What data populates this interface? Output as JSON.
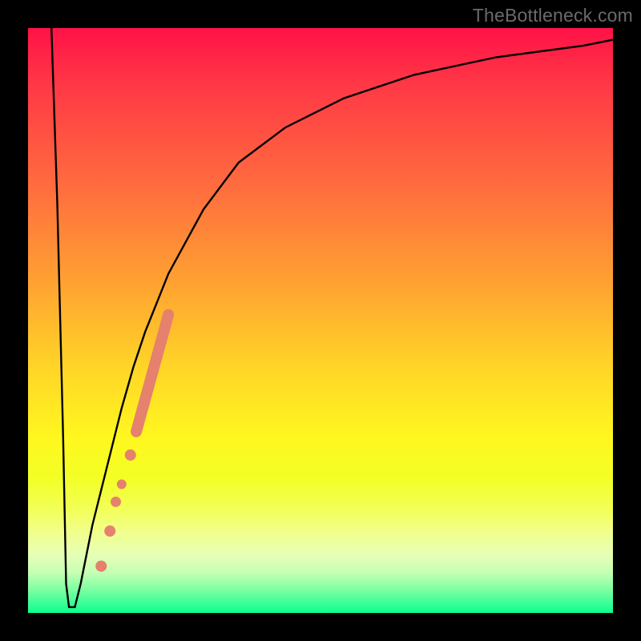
{
  "watermark": "TheBottleneck.com",
  "chart_data": {
    "type": "line",
    "title": "",
    "xlabel": "",
    "ylabel": "",
    "xlim": [
      0,
      100
    ],
    "ylim": [
      0,
      100
    ],
    "grid": false,
    "legend": false,
    "annotations": [],
    "series": [
      {
        "name": "bottleneck-curve",
        "color": "#000000",
        "x": [
          4,
          5,
          6,
          6.5,
          7,
          8,
          9,
          10,
          11,
          12,
          14,
          16,
          18,
          20,
          24,
          30,
          36,
          44,
          54,
          66,
          80,
          95,
          100
        ],
        "y": [
          100,
          70,
          30,
          5,
          1,
          1,
          5,
          10,
          15,
          19,
          27,
          35,
          42,
          48,
          58,
          69,
          77,
          83,
          88,
          92,
          95,
          97,
          98
        ]
      }
    ],
    "markers": [
      {
        "name": "dot-1",
        "x": 12.5,
        "y": 8,
        "r": 7,
        "color": "#e5816d"
      },
      {
        "name": "dot-2",
        "x": 14.0,
        "y": 14,
        "r": 7,
        "color": "#e5816d"
      },
      {
        "name": "dot-3",
        "x": 15.0,
        "y": 19,
        "r": 6.5,
        "color": "#e5816d"
      },
      {
        "name": "dot-4",
        "x": 16.0,
        "y": 22,
        "r": 6,
        "color": "#e5816d"
      },
      {
        "name": "dot-5",
        "x": 17.5,
        "y": 27,
        "r": 7,
        "color": "#e5816d"
      }
    ],
    "segments": [
      {
        "name": "thick-segment",
        "x1": 18.5,
        "y1": 31,
        "x2": 24,
        "y2": 51,
        "width": 14,
        "color": "#e5816d"
      }
    ]
  }
}
